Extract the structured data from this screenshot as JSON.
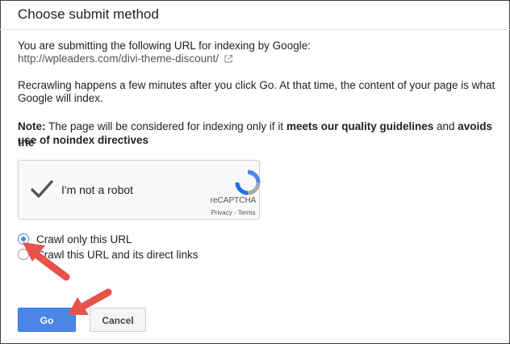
{
  "dialog": {
    "title": "Choose submit method",
    "intro": "You are submitting the following URL for indexing by Google:",
    "url": "http://wpleaders.com/divi-theme-discount/",
    "recrawl_line1": "Recrawling happens a few minutes after you click Go. At that time, the content of your page is what",
    "recrawl_line2": "Google will index.",
    "note": {
      "label": "Note:",
      "text1": " The page will be considered for indexing only if it ",
      "bold1": "meets our quality guidelines",
      "text2": " and ",
      "bold2_line1": "avoids the",
      "bold2_line2": "use of noindex directives"
    }
  },
  "captcha": {
    "label": "I'm not a robot",
    "brand": "reCAPTCHA",
    "links": "Privacy - Terms"
  },
  "options": [
    {
      "label": "Crawl only this URL",
      "selected": true
    },
    {
      "label": "Crawl this URL and its direct links",
      "selected": false
    }
  ],
  "buttons": {
    "go": "Go",
    "cancel": "Cancel"
  },
  "colors": {
    "accent": "#4a86e8",
    "annotation_arrow": "#e8524a"
  }
}
